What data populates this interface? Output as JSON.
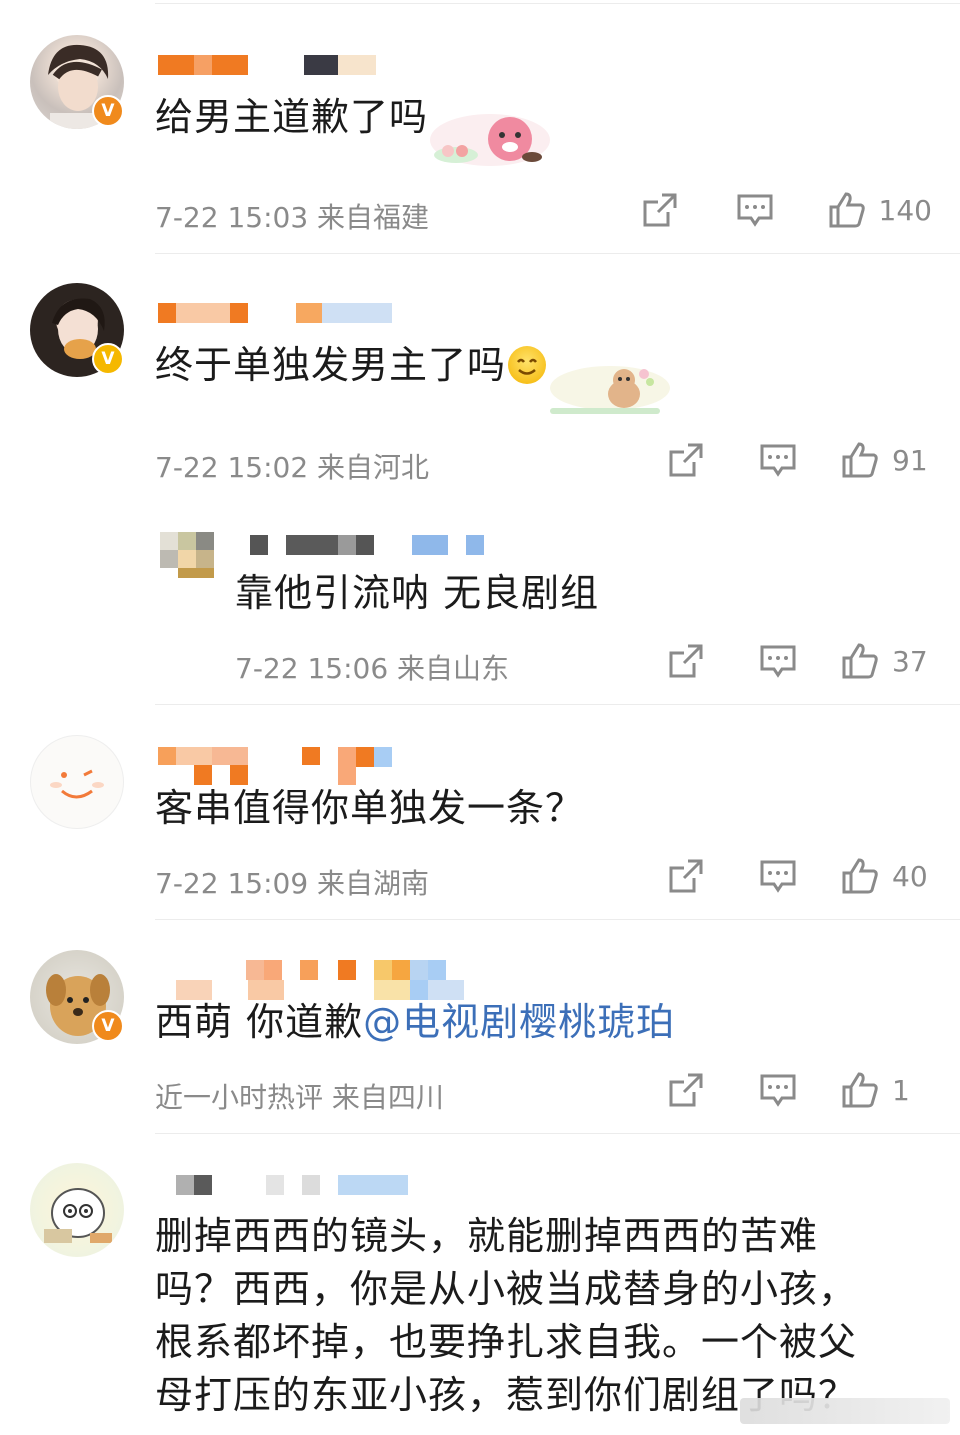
{
  "comments": [
    {
      "text": "给男主道歉了吗",
      "meta": "7-22 15:03 来自福建",
      "likes": "140",
      "badge": "V"
    },
    {
      "text": "终于单独发男主了吗",
      "meta": "7-22 15:02 来自河北",
      "likes": "91",
      "badge": "V"
    },
    {
      "text": "客串值得你单独发一条？",
      "meta": "7-22 15:09 来自湖南",
      "likes": "40"
    },
    {
      "text_prefix": "西萌 你道歉",
      "mention": "@电视剧樱桃琥珀",
      "meta": "近一小时热评 来自四川",
      "likes": "1",
      "badge": "V"
    },
    {
      "text_lines": [
        "删掉西西的镜头，就能删掉西西的苦难",
        "吗？西西，你是从小被当成替身的小孩，",
        "根系都坏掉，也要挣扎求自我。一个被父",
        "母打压的东亚小孩，惹到你们剧组了吗？"
      ]
    }
  ],
  "reply": {
    "text": "靠他引流呐 无良剧组",
    "meta": "7-22 15:06 来自山东",
    "likes": "37"
  },
  "icons": {
    "share": "share-icon",
    "comment": "comment-icon",
    "like": "thumbs-up-icon"
  },
  "colors": {
    "meta_text": "#8a8a8a",
    "mention": "#3c6fb8",
    "badge_orange": "#f08a1c",
    "badge_yellow": "#f5b800"
  }
}
